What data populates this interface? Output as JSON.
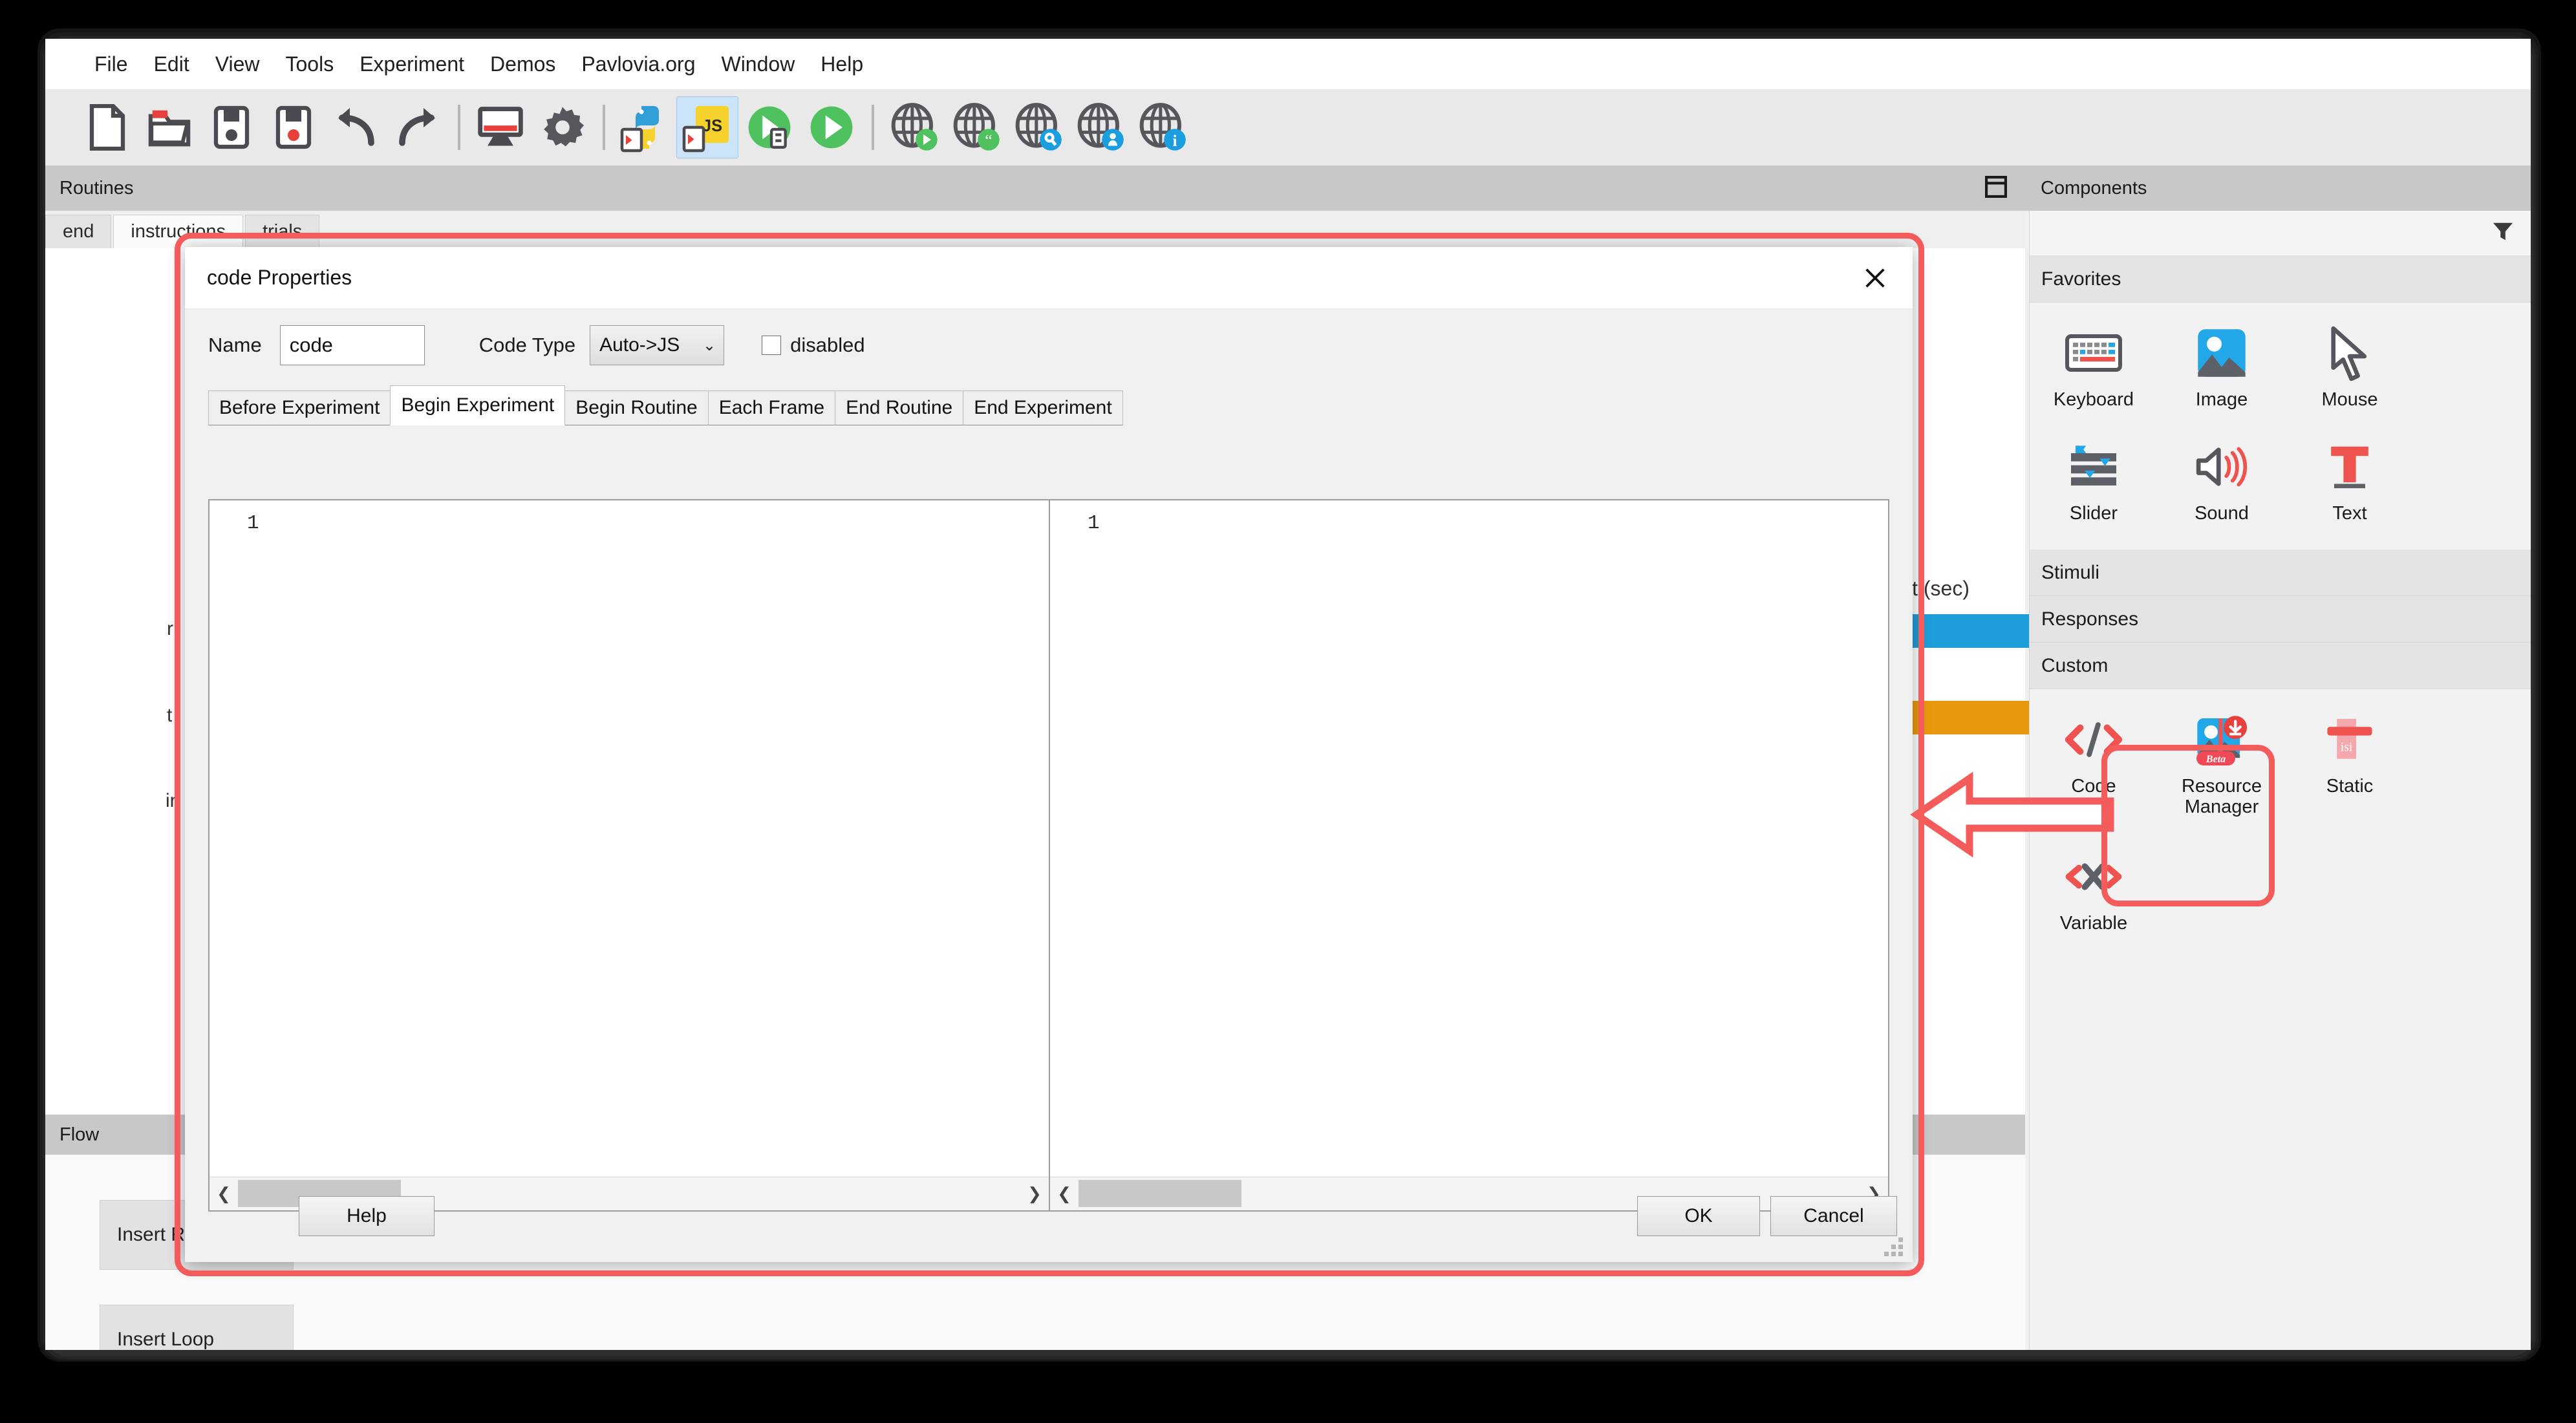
{
  "app": {
    "menu": [
      {
        "label": "File"
      },
      {
        "label": "Edit"
      },
      {
        "label": "View"
      },
      {
        "label": "Tools"
      },
      {
        "label": "Experiment"
      },
      {
        "label": "Demos"
      },
      {
        "label": "Pavlovia.org"
      },
      {
        "label": "Window"
      },
      {
        "label": "Help"
      }
    ],
    "toolbar": [
      {
        "name": "new-file-icon",
        "active": false
      },
      {
        "name": "open-folder-icon",
        "active": false
      },
      {
        "name": "save-icon",
        "active": false
      },
      {
        "name": "save-as-icon",
        "active": false
      },
      {
        "name": "undo-icon",
        "active": false
      },
      {
        "name": "redo-icon",
        "active": false
      },
      {
        "name": "monitor-center-icon",
        "active": false
      },
      {
        "name": "settings-gear-icon",
        "active": false
      },
      {
        "name": "compile-python-icon",
        "active": false
      },
      {
        "name": "compile-js-icon",
        "active": true
      },
      {
        "name": "run-local-icon",
        "active": false
      },
      {
        "name": "run-online-icon",
        "active": false
      },
      {
        "name": "pavlovia-run-icon",
        "active": false
      },
      {
        "name": "pavlovia-sync-icon",
        "active": false
      },
      {
        "name": "pavlovia-search-icon",
        "active": false
      },
      {
        "name": "pavlovia-user-icon",
        "active": false
      },
      {
        "name": "pavlovia-info-icon",
        "active": false
      }
    ]
  },
  "panels": {
    "routines_title": "Routines",
    "components_title": "Components",
    "flow_title": "Flow"
  },
  "routines": {
    "tabs": [
      {
        "label": "end",
        "selected": false
      },
      {
        "label": "instructions",
        "selected": true
      },
      {
        "label": "trials",
        "selected": false
      }
    ],
    "timeline_header": "t (sec)",
    "row_labels": [
      "r",
      "t",
      "in"
    ],
    "bars": [
      {
        "name": "text-component-bar",
        "color": "#1d9dd9"
      },
      {
        "name": "keyboard-component-bar",
        "color": "#e8980c"
      }
    ]
  },
  "flow": {
    "buttons": [
      {
        "label": "Insert Routine"
      },
      {
        "label": "Insert Loop"
      }
    ]
  },
  "components": {
    "filter_icon": "filter-icon",
    "sections": [
      {
        "title": "Favorites",
        "items": [
          {
            "label": "Keyboard",
            "icon": "keyboard-icon"
          },
          {
            "label": "Image",
            "icon": "image-icon"
          },
          {
            "label": "Mouse",
            "icon": "mouse-cursor-icon"
          },
          {
            "label": "Slider",
            "icon": "slider-icon"
          },
          {
            "label": "Sound",
            "icon": "speaker-icon"
          },
          {
            "label": "Text",
            "icon": "text-t-icon"
          }
        ]
      },
      {
        "title": "Stimuli",
        "items": []
      },
      {
        "title": "Responses",
        "items": []
      },
      {
        "title": "Custom",
        "items": [
          {
            "label": "Code",
            "icon": "code-brackets-icon",
            "highlighted": true
          },
          {
            "label": "Resource Manager",
            "icon": "resource-manager-icon",
            "badge": "Beta"
          },
          {
            "label": "Static",
            "icon": "static-isi-icon",
            "badge": "isi"
          },
          {
            "label": "Variable",
            "icon": "variable-brackets-icon"
          }
        ]
      }
    ]
  },
  "dialog": {
    "title": "code Properties",
    "close_icon": "close-icon",
    "name_label": "Name",
    "name_value": "code",
    "code_type_label": "Code Type",
    "code_type_value": "Auto->JS",
    "code_type_chevron": "chevron-down-icon",
    "disabled_label": "disabled",
    "disabled_checked": false,
    "tabs": [
      {
        "label": "Before Experiment",
        "selected": false
      },
      {
        "label": "Begin Experiment",
        "selected": true
      },
      {
        "label": "Begin Routine",
        "selected": false
      },
      {
        "label": "Each Frame",
        "selected": false
      },
      {
        "label": "End Routine",
        "selected": false
      },
      {
        "label": "End Experiment",
        "selected": false
      }
    ],
    "editors": [
      {
        "name": "python-editor",
        "line_number": "1",
        "content": ""
      },
      {
        "name": "javascript-editor",
        "line_number": "1",
        "content": ""
      }
    ],
    "scroll_left_icon": "chevron-left-icon",
    "scroll_right_icon": "chevron-right-icon",
    "buttons": {
      "help": "Help",
      "ok": "OK",
      "cancel": "Cancel"
    }
  },
  "annotations": {
    "color": "#f45b5b",
    "dialog_highlight": "code-properties-dialog-highlight",
    "code_component_highlight": "code-component-highlight",
    "arrow": "left-pointing-arrow"
  }
}
